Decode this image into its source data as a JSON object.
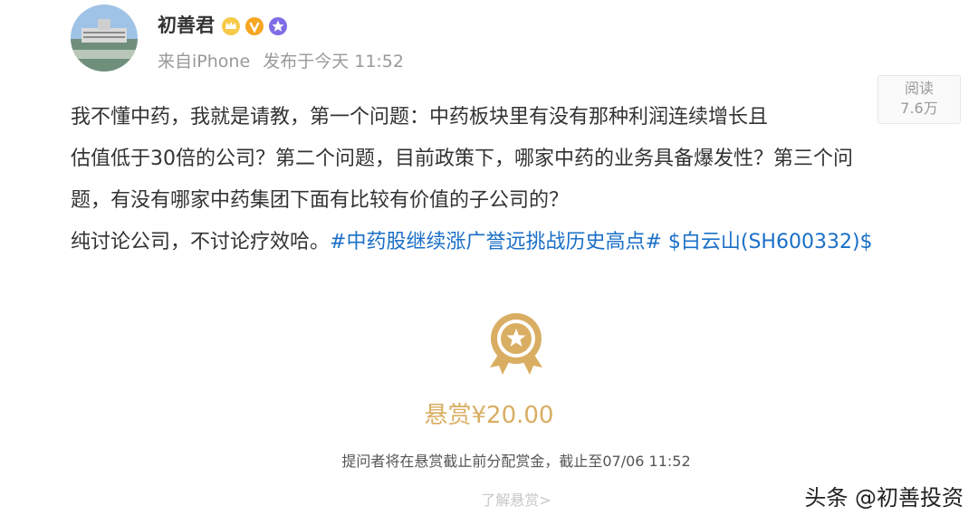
{
  "post": {
    "author": "初善君",
    "source": "来自iPhone",
    "published": "发布于今天 11:52",
    "read_label": "阅读",
    "read_count": "7.6万",
    "lines": [
      "我不懂中药，我就是请教，第一个问题：中药板块里有没有那种利润连续增长且",
      "估值低于30倍的公司？第二个问题，目前政策下，哪家中药的业务具备爆发性？第三个问",
      "题，有没有哪家中药集团下面有比较有价值的子公司的？"
    ],
    "last_line_text": "纯讨论公司，不讨论疗效哈。",
    "topic_tag": "#中药股继续涨广誉远挑战历史高点#",
    "stock_tag": "$白云山(SH600332)$"
  },
  "reward": {
    "amount": "悬赏¥20.00",
    "deadline": "提问者将在悬赏截止前分配赏金，截止至07/06 11:52",
    "learn_more": "了解悬赏>"
  },
  "watermark": "头条 @初善投资",
  "colors": {
    "link": "#1a6fc7",
    "reward": "#d9ae62",
    "meta": "#999999"
  },
  "icons": [
    "crown-badge-icon",
    "verified-v-icon",
    "star-badge-icon",
    "reward-medal-icon"
  ]
}
